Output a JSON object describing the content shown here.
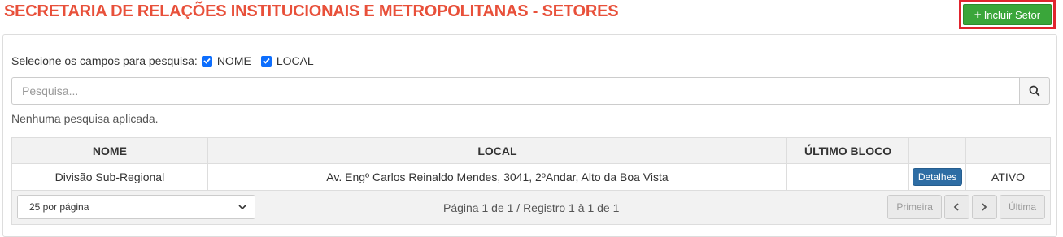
{
  "header": {
    "title": "SECRETARIA DE RELAÇÕES INSTITUCIONAIS E METROPOLITANAS - SETORES",
    "add_button": "Incluir Setor"
  },
  "search": {
    "fields_label": "Selecione os campos para pesquisa:",
    "fields": [
      {
        "label": "NOME",
        "checked": true
      },
      {
        "label": "LOCAL",
        "checked": true
      }
    ],
    "placeholder": "Pesquisa...",
    "status": "Nenhuma pesquisa aplicada."
  },
  "table": {
    "columns": [
      "NOME",
      "LOCAL",
      "ÚLTIMO BLOCO",
      "",
      ""
    ],
    "rows": [
      {
        "nome": "Divisão Sub-Regional",
        "local": "Av. Engº Carlos Reinaldo Mendes, 3041, 2ºAndar, Alto da Boa Vista",
        "ultimo_bloco": "",
        "action": "Detalhes",
        "status": "ATIVO"
      }
    ]
  },
  "footer": {
    "per_page": "25 por página",
    "page_info": "Página 1 de 1 / Registro 1 à 1 de 1",
    "first": "Primeira",
    "last": "Última"
  },
  "colors": {
    "title": "#e8503a",
    "add_button": "#3aa63a",
    "highlight_border": "#e0242e",
    "details_button": "#2e6da4",
    "status_active": "#3c9a3c"
  }
}
